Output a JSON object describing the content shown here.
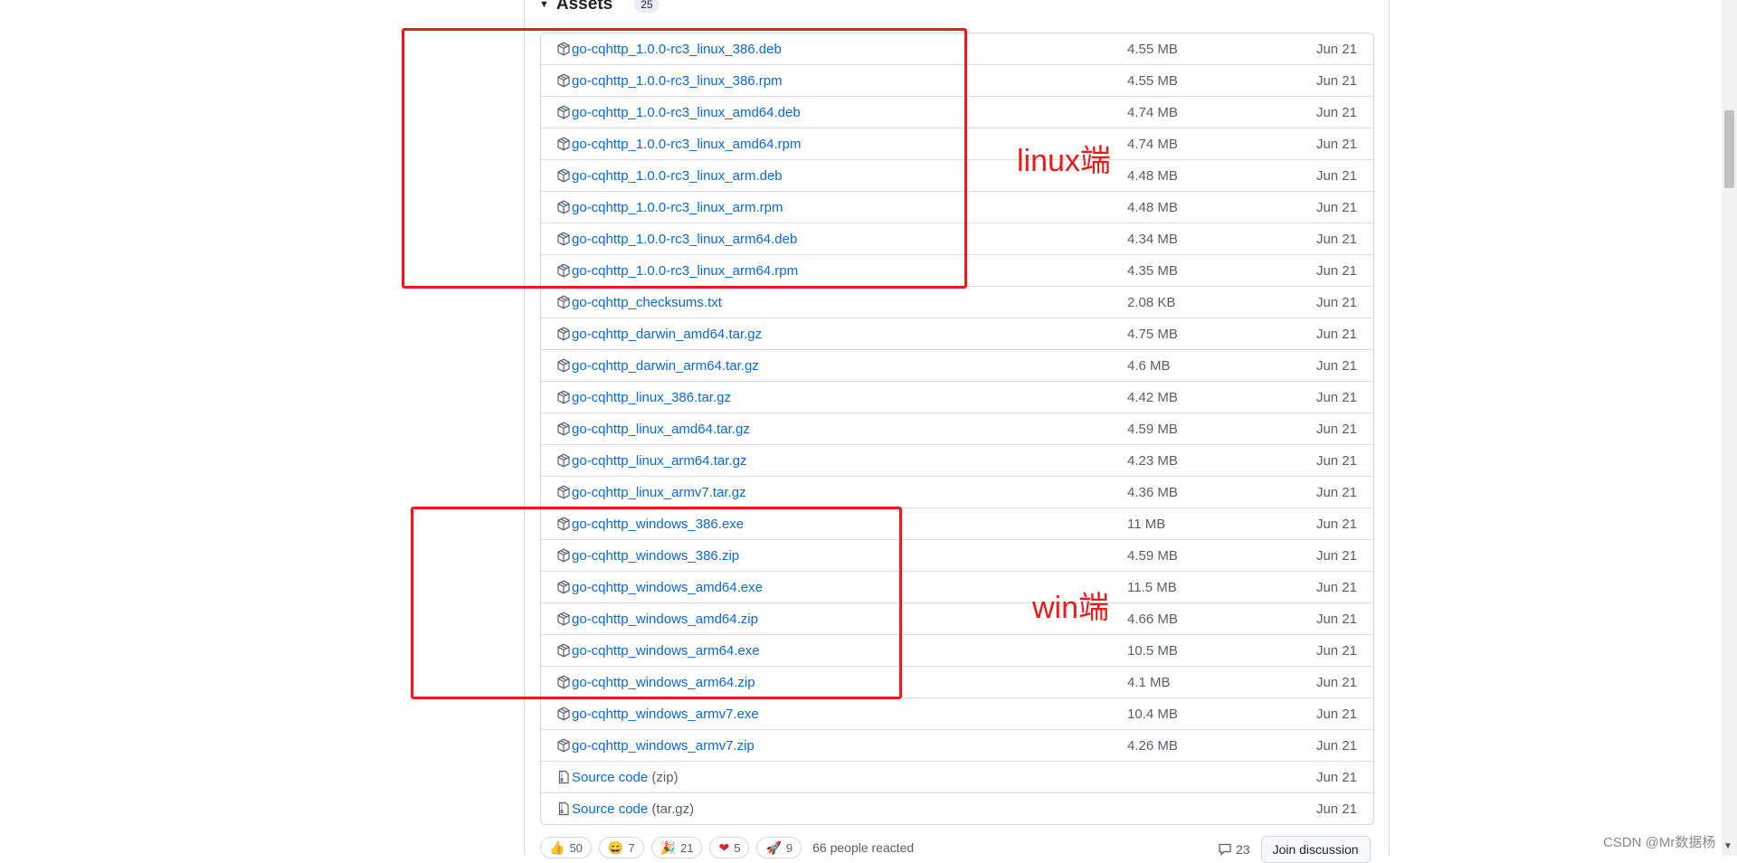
{
  "assets": {
    "title": "Assets",
    "count": "25",
    "items": [
      {
        "name": "go-cqhttp_1.0.0-rc3_linux_386.deb",
        "size": "4.55 MB",
        "date": "Jun 21"
      },
      {
        "name": "go-cqhttp_1.0.0-rc3_linux_386.rpm",
        "size": "4.55 MB",
        "date": "Jun 21"
      },
      {
        "name": "go-cqhttp_1.0.0-rc3_linux_amd64.deb",
        "size": "4.74 MB",
        "date": "Jun 21"
      },
      {
        "name": "go-cqhttp_1.0.0-rc3_linux_amd64.rpm",
        "size": "4.74 MB",
        "date": "Jun 21"
      },
      {
        "name": "go-cqhttp_1.0.0-rc3_linux_arm.deb",
        "size": "4.48 MB",
        "date": "Jun 21"
      },
      {
        "name": "go-cqhttp_1.0.0-rc3_linux_arm.rpm",
        "size": "4.48 MB",
        "date": "Jun 21"
      },
      {
        "name": "go-cqhttp_1.0.0-rc3_linux_arm64.deb",
        "size": "4.34 MB",
        "date": "Jun 21"
      },
      {
        "name": "go-cqhttp_1.0.0-rc3_linux_arm64.rpm",
        "size": "4.35 MB",
        "date": "Jun 21"
      },
      {
        "name": "go-cqhttp_checksums.txt",
        "size": "2.08 KB",
        "date": "Jun 21"
      },
      {
        "name": "go-cqhttp_darwin_amd64.tar.gz",
        "size": "4.75 MB",
        "date": "Jun 21"
      },
      {
        "name": "go-cqhttp_darwin_arm64.tar.gz",
        "size": "4.6 MB",
        "date": "Jun 21"
      },
      {
        "name": "go-cqhttp_linux_386.tar.gz",
        "size": "4.42 MB",
        "date": "Jun 21"
      },
      {
        "name": "go-cqhttp_linux_amd64.tar.gz",
        "size": "4.59 MB",
        "date": "Jun 21"
      },
      {
        "name": "go-cqhttp_linux_arm64.tar.gz",
        "size": "4.23 MB",
        "date": "Jun 21"
      },
      {
        "name": "go-cqhttp_linux_armv7.tar.gz",
        "size": "4.36 MB",
        "date": "Jun 21"
      },
      {
        "name": "go-cqhttp_windows_386.exe",
        "size": "11 MB",
        "date": "Jun 21"
      },
      {
        "name": "go-cqhttp_windows_386.zip",
        "size": "4.59 MB",
        "date": "Jun 21"
      },
      {
        "name": "go-cqhttp_windows_amd64.exe",
        "size": "11.5 MB",
        "date": "Jun 21"
      },
      {
        "name": "go-cqhttp_windows_amd64.zip",
        "size": "4.66 MB",
        "date": "Jun 21"
      },
      {
        "name": "go-cqhttp_windows_arm64.exe",
        "size": "10.5 MB",
        "date": "Jun 21"
      },
      {
        "name": "go-cqhttp_windows_arm64.zip",
        "size": "4.1 MB",
        "date": "Jun 21"
      },
      {
        "name": "go-cqhttp_windows_armv7.exe",
        "size": "10.4 MB",
        "date": "Jun 21"
      },
      {
        "name": "go-cqhttp_windows_armv7.zip",
        "size": "4.26 MB",
        "date": "Jun 21"
      }
    ],
    "source": [
      {
        "name": "Source code",
        "suffix": "(zip)",
        "date": "Jun 21"
      },
      {
        "name": "Source code",
        "suffix": "(tar.gz)",
        "date": "Jun 21"
      }
    ]
  },
  "reactions": {
    "items": [
      {
        "emoji": "👍",
        "count": "50"
      },
      {
        "emoji": "😄",
        "count": "7"
      },
      {
        "emoji": "🎉",
        "count": "21"
      },
      {
        "emoji": "❤",
        "count": "5"
      },
      {
        "emoji": "🚀",
        "count": "9"
      }
    ],
    "summary": "66 people reacted"
  },
  "discussion": {
    "comment_count": "23",
    "join_label": "Join discussion"
  },
  "annotations": {
    "linux_label": "linux端",
    "win_label": "win端",
    "color": "#f01818"
  },
  "watermark": "CSDN @Mr数据杨"
}
